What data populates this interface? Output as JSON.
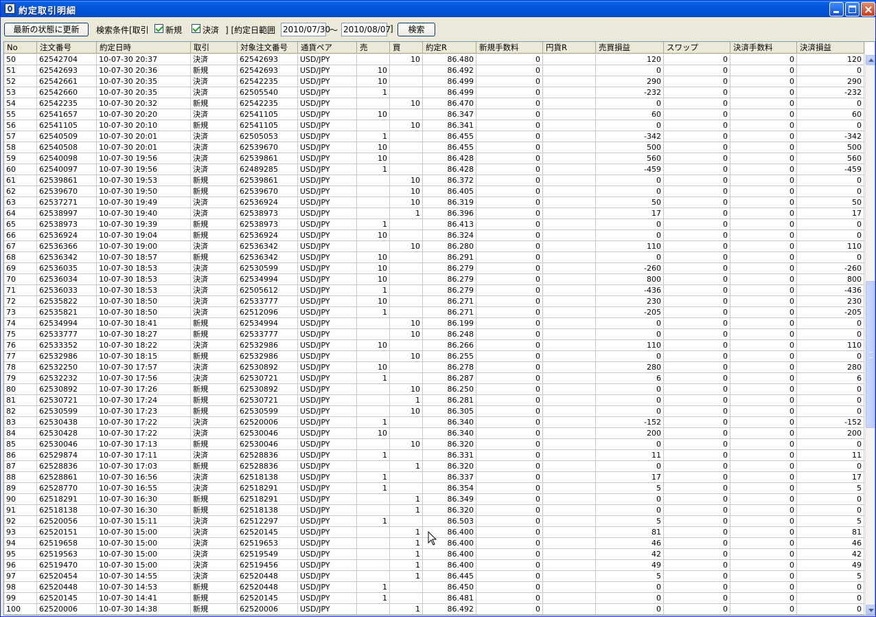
{
  "window": {
    "title": "約定取引明細"
  },
  "toolbar": {
    "refresh_label": "最新の状態に更新",
    "cond_label": "検索条件[取引",
    "new_label": "新規",
    "settle_label": "決済",
    "range_open": "] [約定日範囲",
    "date_from": "2010/07/30",
    "tilde": "〜",
    "date_to": "2010/08/07",
    "range_close": "]",
    "search_label": "検索"
  },
  "table": {
    "columns": [
      "No",
      "注文番号",
      "約定日時",
      "取引",
      "対象注文番号",
      "通貨ペア",
      "売",
      "買",
      "約定R",
      "新規手数料",
      "円貨R",
      "売買損益",
      "スワップ",
      "決済手数料",
      "決済損益"
    ],
    "rows": [
      [
        "50",
        "62542704",
        "10-07-30 20:37",
        "決済",
        "62542693",
        "USD/JPY",
        "",
        "10",
        "86.480",
        "0",
        "",
        "120",
        "0",
        "0",
        "120"
      ],
      [
        "51",
        "62542693",
        "10-07-30 20:36",
        "新規",
        "62542693",
        "USD/JPY",
        "10",
        "",
        "86.492",
        "0",
        "",
        "0",
        "0",
        "0",
        "0"
      ],
      [
        "52",
        "62542661",
        "10-07-30 20:35",
        "決済",
        "62542235",
        "USD/JPY",
        "10",
        "",
        "86.499",
        "0",
        "",
        "290",
        "0",
        "0",
        "290"
      ],
      [
        "53",
        "62542660",
        "10-07-30 20:35",
        "決済",
        "62505540",
        "USD/JPY",
        "1",
        "",
        "86.499",
        "0",
        "",
        "-232",
        "0",
        "0",
        "-232"
      ],
      [
        "54",
        "62542235",
        "10-07-30 20:32",
        "新規",
        "62542235",
        "USD/JPY",
        "",
        "10",
        "86.470",
        "0",
        "",
        "0",
        "0",
        "0",
        "0"
      ],
      [
        "55",
        "62541657",
        "10-07-30 20:20",
        "決済",
        "62541105",
        "USD/JPY",
        "10",
        "",
        "86.347",
        "0",
        "",
        "60",
        "0",
        "0",
        "60"
      ],
      [
        "56",
        "62541105",
        "10-07-30 20:10",
        "新規",
        "62541105",
        "USD/JPY",
        "",
        "10",
        "86.341",
        "0",
        "",
        "0",
        "0",
        "0",
        "0"
      ],
      [
        "57",
        "62540509",
        "10-07-30 20:01",
        "決済",
        "62505053",
        "USD/JPY",
        "1",
        "",
        "86.455",
        "0",
        "",
        "-342",
        "0",
        "0",
        "-342"
      ],
      [
        "58",
        "62540508",
        "10-07-30 20:01",
        "決済",
        "62539670",
        "USD/JPY",
        "10",
        "",
        "86.455",
        "0",
        "",
        "500",
        "0",
        "0",
        "500"
      ],
      [
        "59",
        "62540098",
        "10-07-30 19:56",
        "決済",
        "62539861",
        "USD/JPY",
        "10",
        "",
        "86.428",
        "0",
        "",
        "560",
        "0",
        "0",
        "560"
      ],
      [
        "60",
        "62540097",
        "10-07-30 19:56",
        "決済",
        "62489285",
        "USD/JPY",
        "1",
        "",
        "86.428",
        "0",
        "",
        "-459",
        "0",
        "0",
        "-459"
      ],
      [
        "61",
        "62539861",
        "10-07-30 19:53",
        "新規",
        "62539861",
        "USD/JPY",
        "",
        "10",
        "86.372",
        "0",
        "",
        "0",
        "0",
        "0",
        "0"
      ],
      [
        "62",
        "62539670",
        "10-07-30 19:50",
        "新規",
        "62539670",
        "USD/JPY",
        "",
        "10",
        "86.405",
        "0",
        "",
        "0",
        "0",
        "0",
        "0"
      ],
      [
        "63",
        "62537271",
        "10-07-30 19:49",
        "決済",
        "62536924",
        "USD/JPY",
        "",
        "10",
        "86.319",
        "0",
        "",
        "50",
        "0",
        "0",
        "50"
      ],
      [
        "64",
        "62538997",
        "10-07-30 19:40",
        "決済",
        "62538973",
        "USD/JPY",
        "",
        "1",
        "86.396",
        "0",
        "",
        "17",
        "0",
        "0",
        "17"
      ],
      [
        "65",
        "62538973",
        "10-07-30 19:39",
        "新規",
        "62538973",
        "USD/JPY",
        "1",
        "",
        "86.413",
        "0",
        "",
        "0",
        "0",
        "0",
        "0"
      ],
      [
        "66",
        "62536924",
        "10-07-30 19:04",
        "新規",
        "62536924",
        "USD/JPY",
        "10",
        "",
        "86.324",
        "0",
        "",
        "0",
        "0",
        "0",
        "0"
      ],
      [
        "67",
        "62536366",
        "10-07-30 19:00",
        "決済",
        "62536342",
        "USD/JPY",
        "",
        "10",
        "86.280",
        "0",
        "",
        "110",
        "0",
        "0",
        "110"
      ],
      [
        "68",
        "62536342",
        "10-07-30 18:57",
        "新規",
        "62536342",
        "USD/JPY",
        "10",
        "",
        "86.291",
        "0",
        "",
        "0",
        "0",
        "0",
        "0"
      ],
      [
        "69",
        "62536035",
        "10-07-30 18:53",
        "決済",
        "62530599",
        "USD/JPY",
        "10",
        "",
        "86.279",
        "0",
        "",
        "-260",
        "0",
        "0",
        "-260"
      ],
      [
        "70",
        "62536034",
        "10-07-30 18:53",
        "決済",
        "62534994",
        "USD/JPY",
        "10",
        "",
        "86.279",
        "0",
        "",
        "800",
        "0",
        "0",
        "800"
      ],
      [
        "71",
        "62536033",
        "10-07-30 18:53",
        "決済",
        "62505612",
        "USD/JPY",
        "1",
        "",
        "86.279",
        "0",
        "",
        "-436",
        "0",
        "0",
        "-436"
      ],
      [
        "72",
        "62535822",
        "10-07-30 18:50",
        "決済",
        "62533777",
        "USD/JPY",
        "10",
        "",
        "86.271",
        "0",
        "",
        "230",
        "0",
        "0",
        "230"
      ],
      [
        "73",
        "62535821",
        "10-07-30 18:50",
        "決済",
        "62512096",
        "USD/JPY",
        "1",
        "",
        "86.271",
        "0",
        "",
        "-205",
        "0",
        "0",
        "-205"
      ],
      [
        "74",
        "62534994",
        "10-07-30 18:41",
        "新規",
        "62534994",
        "USD/JPY",
        "",
        "10",
        "86.199",
        "0",
        "",
        "0",
        "0",
        "0",
        "0"
      ],
      [
        "75",
        "62533777",
        "10-07-30 18:27",
        "新規",
        "62533777",
        "USD/JPY",
        "",
        "10",
        "86.248",
        "0",
        "",
        "0",
        "0",
        "0",
        "0"
      ],
      [
        "76",
        "62533352",
        "10-07-30 18:22",
        "決済",
        "62532986",
        "USD/JPY",
        "10",
        "",
        "86.266",
        "0",
        "",
        "110",
        "0",
        "0",
        "110"
      ],
      [
        "77",
        "62532986",
        "10-07-30 18:15",
        "新規",
        "62532986",
        "USD/JPY",
        "",
        "10",
        "86.255",
        "0",
        "",
        "0",
        "0",
        "0",
        "0"
      ],
      [
        "78",
        "62532250",
        "10-07-30 17:57",
        "決済",
        "62530892",
        "USD/JPY",
        "10",
        "",
        "86.278",
        "0",
        "",
        "280",
        "0",
        "0",
        "280"
      ],
      [
        "79",
        "62532232",
        "10-07-30 17:56",
        "決済",
        "62530721",
        "USD/JPY",
        "1",
        "",
        "86.287",
        "0",
        "",
        "6",
        "0",
        "0",
        "6"
      ],
      [
        "80",
        "62530892",
        "10-07-30 17:26",
        "新規",
        "62530892",
        "USD/JPY",
        "",
        "10",
        "86.250",
        "0",
        "",
        "0",
        "0",
        "0",
        "0"
      ],
      [
        "81",
        "62530721",
        "10-07-30 17:24",
        "新規",
        "62530721",
        "USD/JPY",
        "",
        "1",
        "86.281",
        "0",
        "",
        "0",
        "0",
        "0",
        "0"
      ],
      [
        "82",
        "62530599",
        "10-07-30 17:23",
        "新規",
        "62530599",
        "USD/JPY",
        "",
        "10",
        "86.305",
        "0",
        "",
        "0",
        "0",
        "0",
        "0"
      ],
      [
        "83",
        "62530438",
        "10-07-30 17:22",
        "決済",
        "62520006",
        "USD/JPY",
        "1",
        "",
        "86.340",
        "0",
        "",
        "-152",
        "0",
        "0",
        "-152"
      ],
      [
        "84",
        "62530428",
        "10-07-30 17:22",
        "決済",
        "62530046",
        "USD/JPY",
        "10",
        "",
        "86.340",
        "0",
        "",
        "200",
        "0",
        "0",
        "200"
      ],
      [
        "85",
        "62530046",
        "10-07-30 17:13",
        "新規",
        "62530046",
        "USD/JPY",
        "",
        "10",
        "86.320",
        "0",
        "",
        "0",
        "0",
        "0",
        "0"
      ],
      [
        "86",
        "62529874",
        "10-07-30 17:11",
        "決済",
        "62528836",
        "USD/JPY",
        "1",
        "",
        "86.331",
        "0",
        "",
        "11",
        "0",
        "0",
        "11"
      ],
      [
        "87",
        "62528836",
        "10-07-30 17:03",
        "新規",
        "62528836",
        "USD/JPY",
        "",
        "1",
        "86.320",
        "0",
        "",
        "0",
        "0",
        "0",
        "0"
      ],
      [
        "88",
        "62528861",
        "10-07-30 16:56",
        "決済",
        "62518138",
        "USD/JPY",
        "1",
        "",
        "86.337",
        "0",
        "",
        "17",
        "0",
        "0",
        "17"
      ],
      [
        "89",
        "62528770",
        "10-07-30 16:55",
        "決済",
        "62518291",
        "USD/JPY",
        "1",
        "",
        "86.354",
        "0",
        "",
        "5",
        "0",
        "0",
        "5"
      ],
      [
        "90",
        "62518291",
        "10-07-30 16:30",
        "新規",
        "62518291",
        "USD/JPY",
        "",
        "1",
        "86.349",
        "0",
        "",
        "0",
        "0",
        "0",
        "0"
      ],
      [
        "91",
        "62518138",
        "10-07-30 16:30",
        "新規",
        "62518138",
        "USD/JPY",
        "",
        "1",
        "86.320",
        "0",
        "",
        "0",
        "0",
        "0",
        "0"
      ],
      [
        "92",
        "62520056",
        "10-07-30 15:11",
        "決済",
        "62512297",
        "USD/JPY",
        "1",
        "",
        "86.503",
        "0",
        "",
        "5",
        "0",
        "0",
        "5"
      ],
      [
        "93",
        "62520151",
        "10-07-30 15:00",
        "決済",
        "62520145",
        "USD/JPY",
        "",
        "1",
        "86.400",
        "0",
        "",
        "81",
        "0",
        "0",
        "81"
      ],
      [
        "94",
        "62519658",
        "10-07-30 15:00",
        "決済",
        "62519653",
        "USD/JPY",
        "",
        "1",
        "86.400",
        "0",
        "",
        "46",
        "0",
        "0",
        "46"
      ],
      [
        "95",
        "62519563",
        "10-07-30 15:00",
        "決済",
        "62519549",
        "USD/JPY",
        "",
        "1",
        "86.400",
        "0",
        "",
        "42",
        "0",
        "0",
        "42"
      ],
      [
        "96",
        "62519470",
        "10-07-30 15:00",
        "決済",
        "62519456",
        "USD/JPY",
        "",
        "1",
        "86.400",
        "0",
        "",
        "49",
        "0",
        "0",
        "49"
      ],
      [
        "97",
        "62520454",
        "10-07-30 14:55",
        "決済",
        "62520448",
        "USD/JPY",
        "",
        "1",
        "86.445",
        "0",
        "",
        "5",
        "0",
        "0",
        "5"
      ],
      [
        "98",
        "62520448",
        "10-07-30 14:53",
        "新規",
        "62520448",
        "USD/JPY",
        "1",
        "",
        "86.450",
        "0",
        "",
        "0",
        "0",
        "0",
        "0"
      ],
      [
        "99",
        "62520145",
        "10-07-30 14:41",
        "新規",
        "62520145",
        "USD/JPY",
        "1",
        "",
        "86.481",
        "0",
        "",
        "0",
        "0",
        "0",
        "0"
      ],
      [
        "100",
        "62520006",
        "10-07-30 14:38",
        "新規",
        "62520006",
        "USD/JPY",
        "",
        "1",
        "86.492",
        "0",
        "",
        "0",
        "0",
        "0",
        "0"
      ]
    ]
  },
  "scrollbar": {
    "position_fraction": 0.55
  },
  "colors": {
    "title_bar": "#0453d6",
    "face": "#ece9d8",
    "grid_line": "#c8c8c8",
    "check": "#21a121"
  },
  "icons": {
    "app": "app-icon",
    "minimize": "minimize-icon",
    "maximize": "maximize-icon",
    "close": "close-icon",
    "check": "check-icon",
    "cursor": "mouse-pointer-icon"
  }
}
